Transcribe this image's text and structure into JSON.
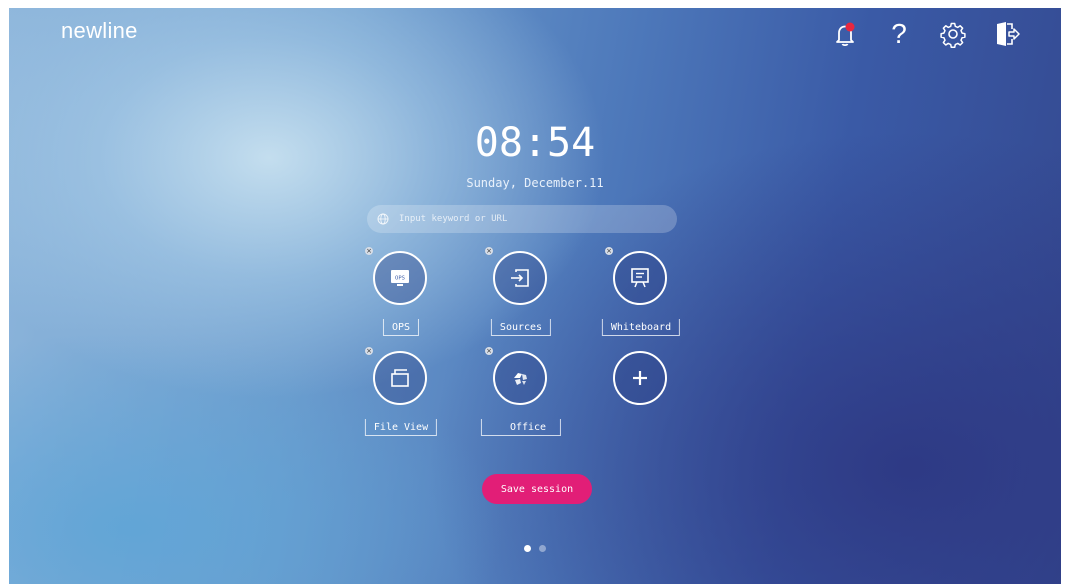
{
  "brand": {
    "name": "newline"
  },
  "top_bar": {
    "icons": [
      "notification-bell-icon",
      "help-icon",
      "settings-gear-icon",
      "exit-door-icon"
    ],
    "help_glyph": "?",
    "notification_dot_color": "#e8283f"
  },
  "clock": {
    "time": "08:54",
    "date": "Sunday, December.11"
  },
  "search": {
    "placeholder": "Input keyword or URL"
  },
  "apps": [
    {
      "label": "OPS",
      "icon": "ops-monitor-icon",
      "removable": true
    },
    {
      "label": "Sources",
      "icon": "input-source-icon",
      "removable": true
    },
    {
      "label": "Whiteboard",
      "icon": "whiteboard-icon",
      "removable": true
    },
    {
      "label": "File View",
      "icon": "folder-icon",
      "removable": true
    },
    {
      "label": "Office",
      "icon": "office-icon",
      "removable": true
    },
    {
      "label": "",
      "icon": "plus-icon",
      "removable": false
    }
  ],
  "ops_icon_text": "OPS",
  "delete_glyph": "×",
  "save_session": {
    "label": "Save session",
    "color": "#e21e77"
  },
  "pager": {
    "pages": 2,
    "current": 1
  }
}
